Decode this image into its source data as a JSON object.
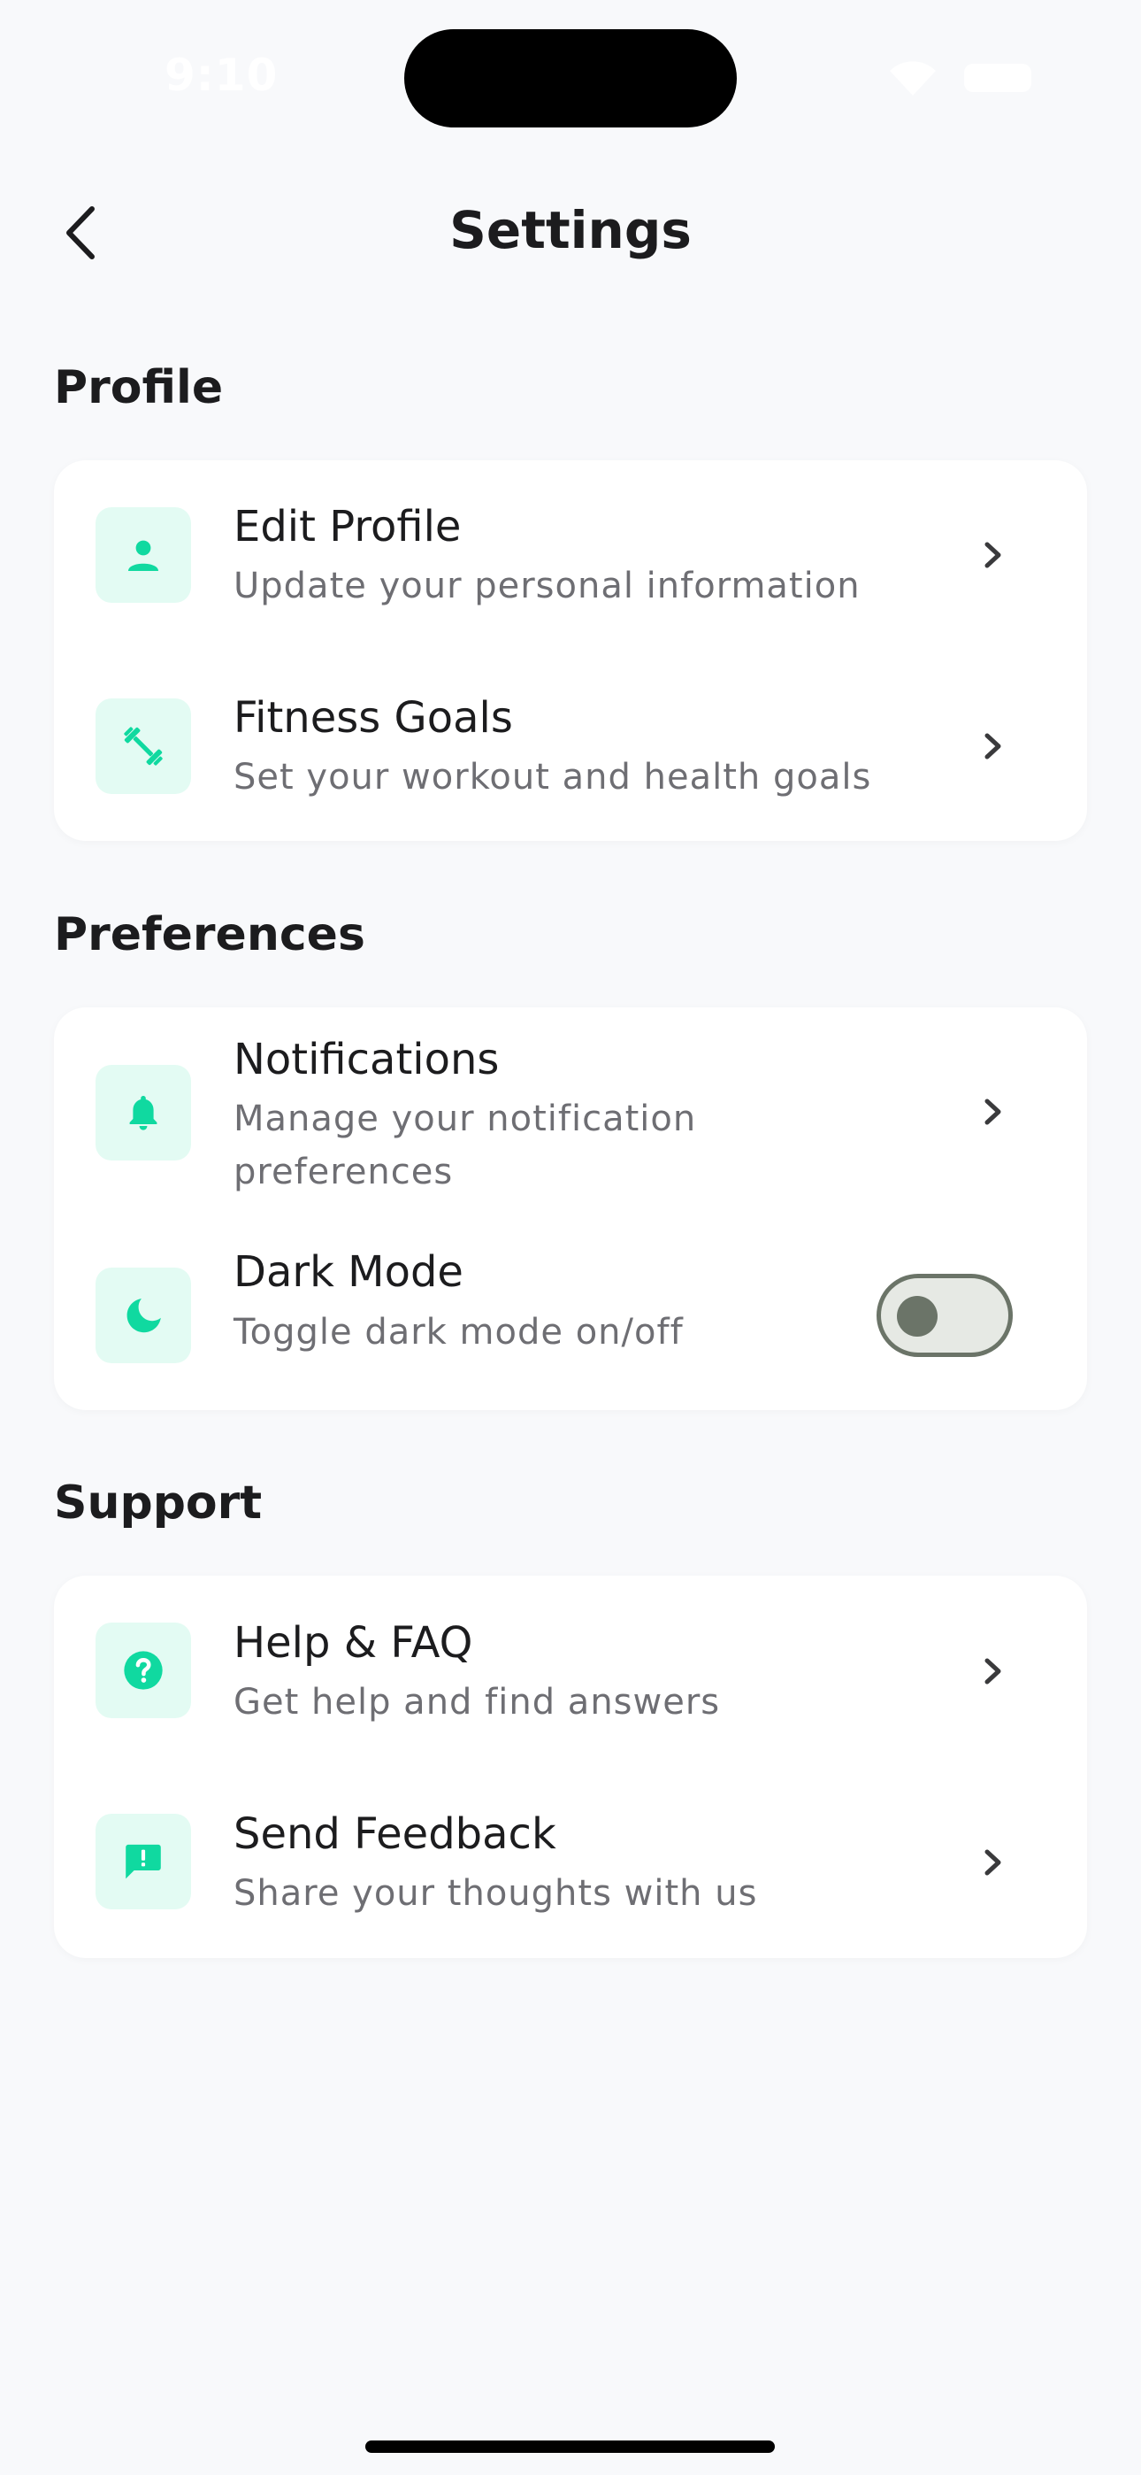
{
  "status_bar": {
    "time": "9:10"
  },
  "header": {
    "title": "Settings"
  },
  "sections": {
    "profile": {
      "heading": "Profile",
      "items": [
        {
          "title": "Edit Profile",
          "subtitle": "Update your personal information",
          "icon": "person-icon"
        },
        {
          "title": "Fitness Goals",
          "subtitle": "Set your workout and health goals",
          "icon": "dumbbell-icon"
        }
      ]
    },
    "preferences": {
      "heading": "Preferences",
      "items": [
        {
          "title": "Notifications",
          "subtitle": "Manage your notification preferences",
          "icon": "bell-icon"
        },
        {
          "title": "Dark Mode",
          "subtitle": "Toggle dark mode on/off",
          "icon": "moon-icon",
          "toggle_on": false
        }
      ]
    },
    "support": {
      "heading": "Support",
      "items": [
        {
          "title": "Help & FAQ",
          "subtitle": "Get help and find answers",
          "icon": "help-circle-icon"
        },
        {
          "title": "Send Feedback",
          "subtitle": "Share your thoughts with us",
          "icon": "feedback-icon"
        }
      ]
    }
  },
  "colors": {
    "accent": "#10d9a0",
    "icon_background": "#e3fbf3",
    "page_background": "#f8f9fb",
    "card_background": "#ffffff",
    "subtitle_text": "#6e6e73",
    "toggle_off": "#6b7468"
  }
}
